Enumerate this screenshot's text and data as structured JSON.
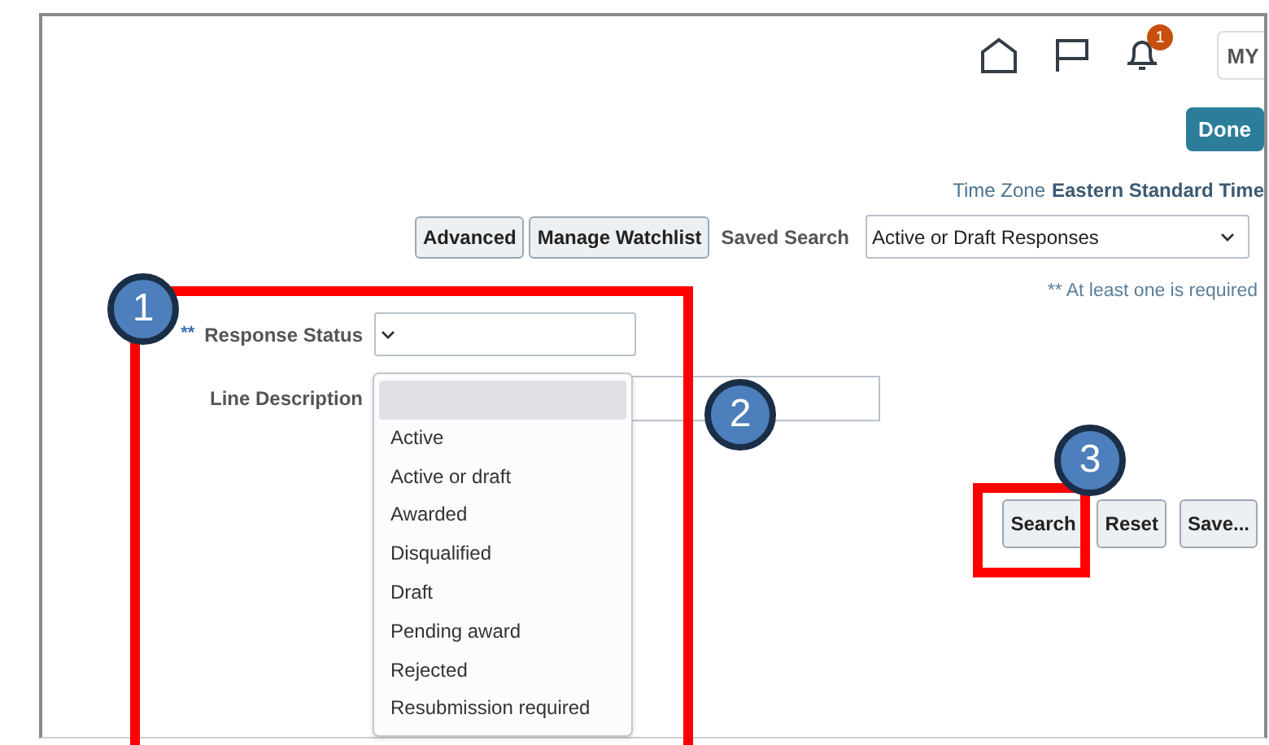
{
  "header": {
    "notification_count": "1",
    "avatar_initials": "MY"
  },
  "done_button": "Done",
  "time_zone": {
    "label": "Time Zone",
    "value": "Eastern Standard Time"
  },
  "toolbar": {
    "buttons": [
      "Advanced",
      "Manage Watchlist"
    ],
    "saved_search_label": "Saved Search",
    "saved_search_value": "Active or Draft Responses"
  },
  "required_note": "** At least one is required",
  "fields": [
    {
      "kind": "select",
      "required_mark": "**",
      "label": "Response Status"
    },
    {
      "kind": "text",
      "label": "Line Description"
    }
  ],
  "dropdown_options": [
    {
      "selected": true
    },
    {
      "label": "Active",
      "selected": false
    },
    {
      "label": "Active or draft",
      "selected": false
    },
    {
      "label": "Awarded",
      "selected": false
    },
    {
      "label": "Disqualified",
      "selected": false
    },
    {
      "label": "Draft",
      "selected": false
    },
    {
      "label": "Pending award",
      "selected": false
    },
    {
      "label": "Rejected",
      "selected": false
    },
    {
      "label": "Resubmission required",
      "selected": false
    }
  ],
  "action_buttons": [
    "Search",
    "Reset",
    "Save..."
  ],
  "annotations": [
    {
      "label": "1"
    },
    {
      "label": "2"
    },
    {
      "label": "3"
    }
  ]
}
